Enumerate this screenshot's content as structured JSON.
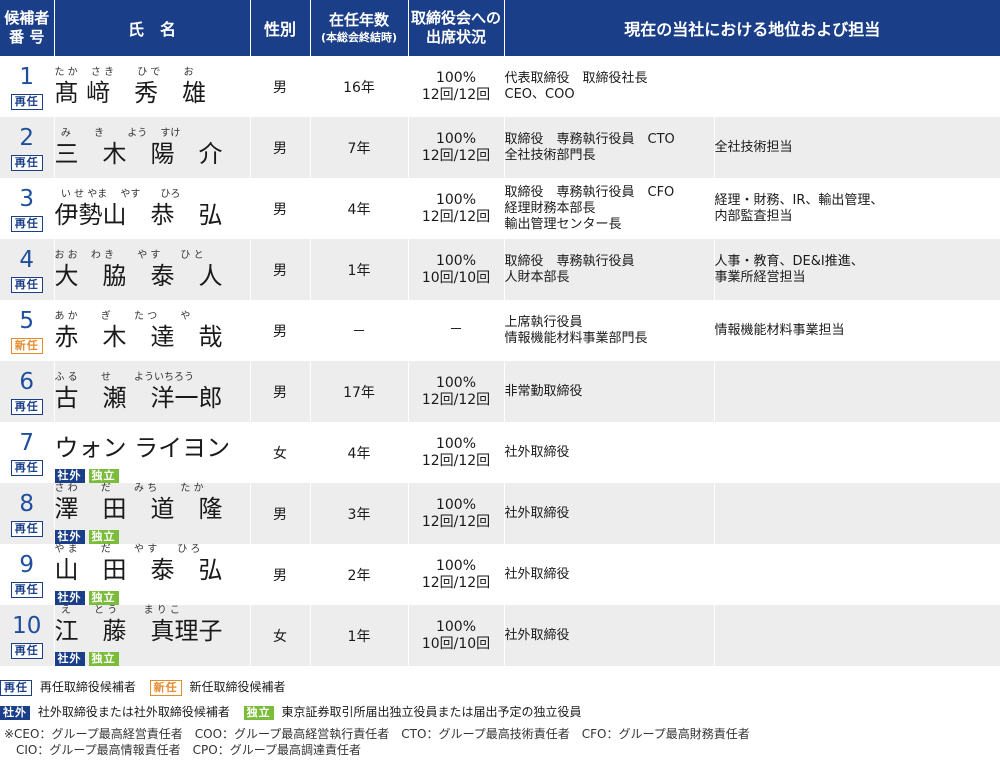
{
  "headers": {
    "no": "候補者番号",
    "no_l1": "候補者",
    "no_l2": "番 号",
    "name": "氏　名",
    "gender": "性別",
    "years_l1": "在任年数",
    "years_l2": "(本総会終結時)",
    "att_l1": "取締役会への",
    "att_l2": "出席状況",
    "position": "現在の当社における地位および担当"
  },
  "candidates": [
    {
      "no": "1",
      "status": "再任",
      "kana": "た か　 さ き　　 ひ で　　 お",
      "kanji": "髙 﨑　秀　雄",
      "gender": "男",
      "years": "16年",
      "att_pct": "100%",
      "att_cnt": "12回/12回",
      "pos": "代表取締役　取締役社長\nCEO、COO",
      "duty": ""
    },
    {
      "no": "2",
      "status": "再任",
      "kana": "  み　　 き　　 よう　 すけ",
      "kanji": "三　木　陽　介",
      "gender": "男",
      "years": "7年",
      "att_pct": "100%",
      "att_cnt": "12回/12回",
      "pos": "取締役　専務執行役員　CTO\n全社技術部門長",
      "duty": "全社技術担当"
    },
    {
      "no": "3",
      "status": "再任",
      "kana": "  い せ やま　 やす　　ひろ",
      "kanji": "伊勢山　恭　弘",
      "gender": "男",
      "years": "4年",
      "att_pct": "100%",
      "att_cnt": "12回/12回",
      "pos": "取締役　専務執行役員　CFO\n経理財務本部長\n輸出管理センター長",
      "duty": "経理・財務、IR、輸出管理、\n内部監査担当"
    },
    {
      "no": "4",
      "status": "再任",
      "kana": "お お　 わ き　　 や す　　ひ と",
      "kanji": "大　脇　泰　人",
      "gender": "男",
      "years": "1年",
      "att_pct": "100%",
      "att_cnt": "10回/10回",
      "pos": "取締役　専務執行役員\n人財本部長",
      "duty": "人事・教育、DE&I推進、\n事業所経営担当"
    },
    {
      "no": "5",
      "status": "新任",
      "kana": "あ か　　 ぎ　　 た つ　　 や",
      "kanji": "赤　木　達　哉",
      "gender": "男",
      "years": "－",
      "att_pct": "－",
      "att_cnt": "",
      "pos": "上席執行役員\n情報機能材料事業部門長",
      "duty": "情報機能材料事業担当"
    },
    {
      "no": "6",
      "status": "再任",
      "kana": "ふ る　　 せ　　 よういちろう",
      "kanji": "古　瀬　洋一郎",
      "gender": "男",
      "years": "17年",
      "att_pct": "100%",
      "att_cnt": "12回/12回",
      "pos": "非常勤取締役",
      "duty": ""
    },
    {
      "no": "7",
      "status": "再任",
      "kana": "",
      "kanji": "ウォン ライヨン",
      "gender": "女",
      "years": "4年",
      "att_pct": "100%",
      "att_cnt": "12回/12回",
      "pos": "社外取締役",
      "duty": "",
      "outside": "社外",
      "independent": "独立"
    },
    {
      "no": "8",
      "status": "再任",
      "kana": "さ わ　　 だ　　 み ち　　 た か",
      "kanji": "澤　田　道　隆",
      "gender": "男",
      "years": "3年",
      "att_pct": "100%",
      "att_cnt": "12回/12回",
      "pos": "社外取締役",
      "duty": "",
      "outside": "社外",
      "independent": "独立"
    },
    {
      "no": "9",
      "status": "再任",
      "kana": "や ま　　 だ　　 や す　　ひ ろ",
      "kanji": "山　田　泰　弘",
      "gender": "男",
      "years": "2年",
      "att_pct": "100%",
      "att_cnt": "12回/12回",
      "pos": "社外取締役",
      "duty": "",
      "outside": "社外",
      "independent": "独立"
    },
    {
      "no": "10",
      "status": "再任",
      "kana": "  え　　 と う　　  ま り こ",
      "kanji": "江　藤　真理子",
      "gender": "女",
      "years": "1年",
      "att_pct": "100%",
      "att_cnt": "10回/10回",
      "pos": "社外取締役",
      "duty": "",
      "outside": "社外",
      "independent": "独立"
    }
  ],
  "legend": {
    "re_badge": "再任",
    "re_text": "再任取締役候補者",
    "new_badge": "新任",
    "new_text": "新任取締役候補者",
    "out_badge": "社外",
    "out_text": "社外取締役または社外取締役候補者",
    "ind_badge": "独立",
    "ind_text": "東京証券取引所届出独立役員または届出予定の独立役員"
  },
  "notes": {
    "line1": "※CEO：グループ最高経営責任者　COO：グループ最高経営執行責任者　CTO：グループ最高技術責任者　CFO：グループ最高財務責任者",
    "line2": "　CIO：グループ最高情報責任者　CPO：グループ最高調達責任者"
  },
  "colors": {
    "header": "#1a3e87",
    "number": "#1d4f9c",
    "new": "#e68a2e",
    "independent": "#7bbd3b",
    "row_alt": "#ededed"
  }
}
